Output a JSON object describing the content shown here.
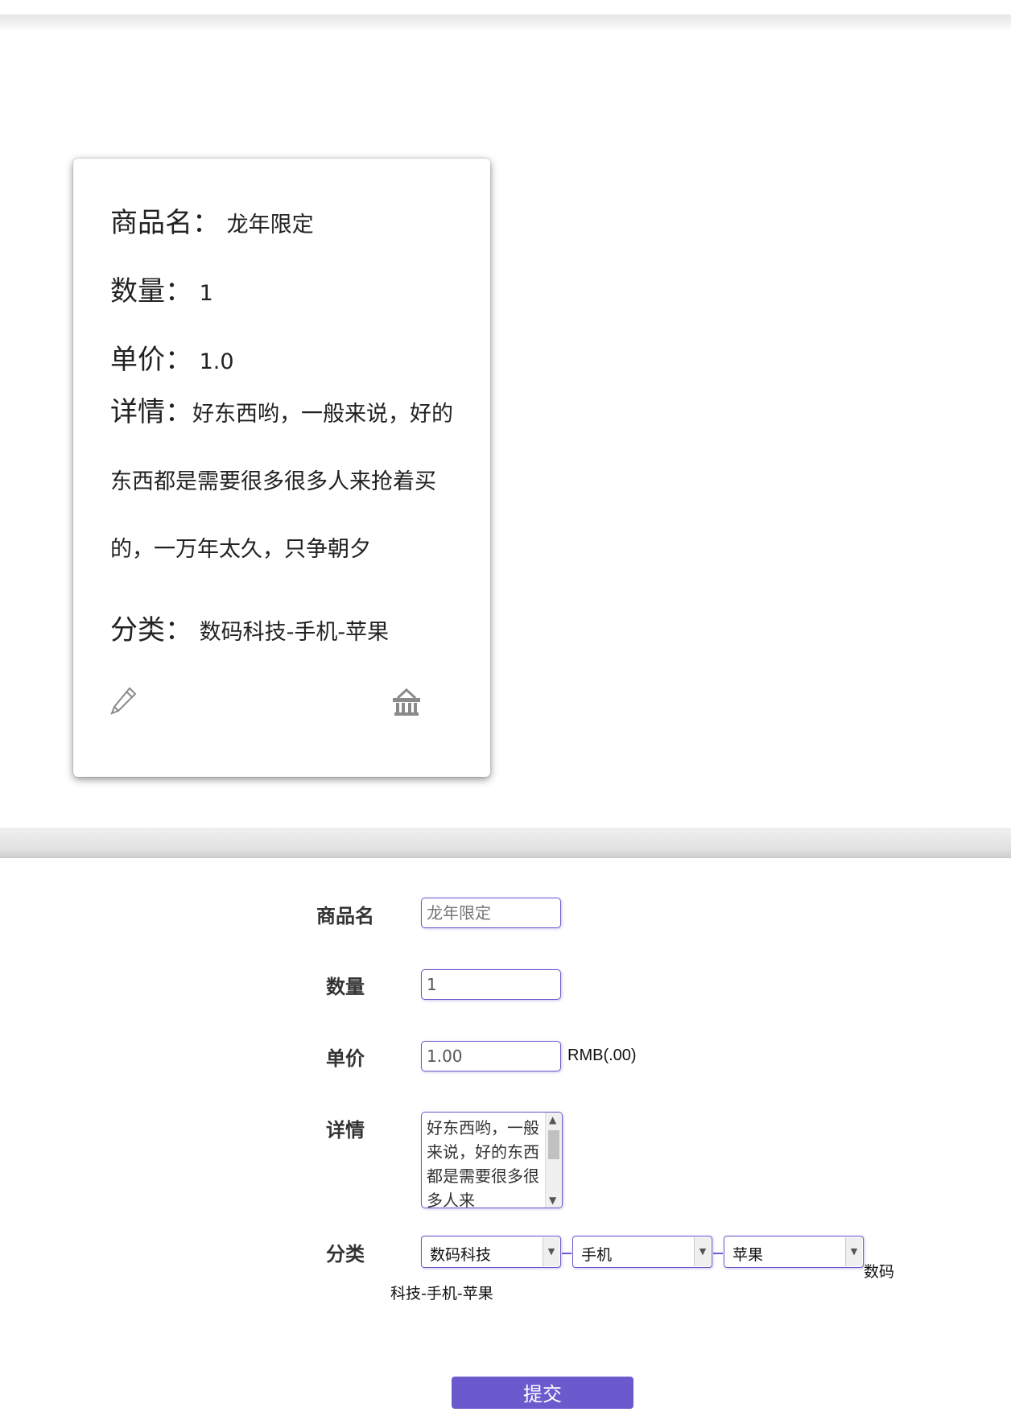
{
  "card": {
    "name_label": "商品名：",
    "name_value": "龙年限定",
    "qty_label": "数量：",
    "qty_value": "1",
    "price_label": "单价：",
    "price_value": "1.0",
    "detail_label": "详情：",
    "detail_value": "好东西哟，一般来说，好的东西都是需要很多很多人来抢着买的，一万年太久，只争朝夕",
    "category_label": "分类：",
    "category_value": "数码科技-手机-苹果"
  },
  "form": {
    "name_label": "商品名",
    "name_placeholder": "龙年限定",
    "qty_label": "数量",
    "qty_value": "1",
    "price_label": "单价",
    "price_value": "1.00",
    "price_unit": "RMB(.00)",
    "detail_label": "详情",
    "detail_value": "好东西哟，一般来说，好的东西都是需要很多很多人来",
    "category_label": "分类",
    "category_select_1": "数码科技",
    "category_select_2": "手机",
    "category_select_3": "苹果",
    "category_text_a": "数码",
    "category_text_b": "科技-手机-苹果",
    "submit_label": "提交"
  },
  "icons": {
    "edit": "pencil-icon",
    "cart": "basket-icon"
  },
  "colors": {
    "accent": "#6a5acd"
  }
}
